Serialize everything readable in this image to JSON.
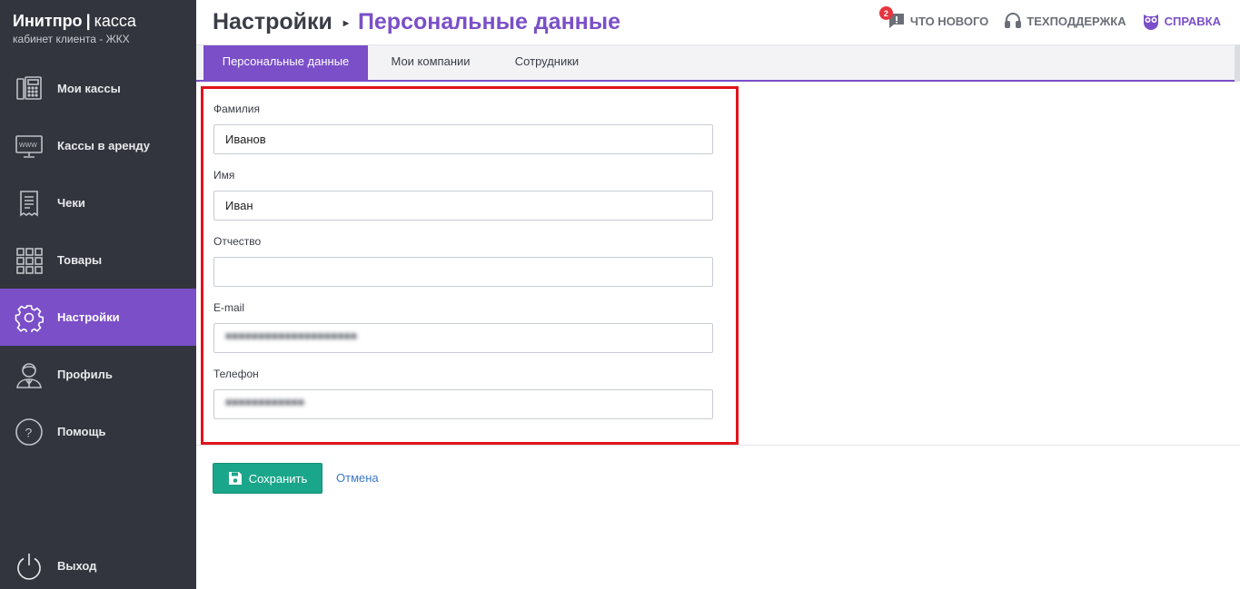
{
  "brand": {
    "name_bold": "Инитпро",
    "separator": "|",
    "name_light": "касса",
    "subtitle": "кабинет клиента - ЖКХ"
  },
  "sidebar": {
    "items": [
      {
        "label": "Мои кассы",
        "icon": "cash-register-icon"
      },
      {
        "label": "Кассы в аренду",
        "icon": "www-monitor-icon"
      },
      {
        "label": "Чеки",
        "icon": "receipt-icon"
      },
      {
        "label": "Товары",
        "icon": "grid-icon"
      },
      {
        "label": "Настройки",
        "icon": "gear-icon",
        "active": true
      },
      {
        "label": "Профиль",
        "icon": "user-icon"
      },
      {
        "label": "Помощь",
        "icon": "question-icon"
      }
    ],
    "logout": {
      "label": "Выход",
      "icon": "power-icon"
    }
  },
  "header": {
    "breadcrumb_root": "Настройки",
    "breadcrumb_arrow": "▸",
    "breadcrumb_current": "Персональные данные",
    "news": {
      "label": "ЧТО НОВОГО",
      "badge": "2",
      "icon": "chat-icon"
    },
    "support": {
      "label": "ТЕХПОДДЕРЖКА",
      "icon": "headset-icon"
    },
    "help": {
      "label": "СПРАВКА",
      "icon": "owl-icon"
    }
  },
  "tabs": [
    {
      "label": "Персональные данные",
      "active": true
    },
    {
      "label": "Мои компании",
      "active": false
    },
    {
      "label": "Сотрудники",
      "active": false
    }
  ],
  "form": {
    "lastname": {
      "label": "Фамилия",
      "value": "Иванов"
    },
    "firstname": {
      "label": "Имя",
      "value": "Иван"
    },
    "middlename": {
      "label": "Отчество",
      "value": ""
    },
    "email": {
      "label": "E-mail",
      "value": ""
    },
    "phone": {
      "label": "Телефон",
      "value": ""
    }
  },
  "actions": {
    "save_label": "Сохранить",
    "cancel_label": "Отмена"
  },
  "colors": {
    "sidebar_bg": "#32353d",
    "accent": "#7a4fc8",
    "save": "#1aa68a",
    "highlight_border": "#e0141e",
    "badge": "#e8343f"
  }
}
